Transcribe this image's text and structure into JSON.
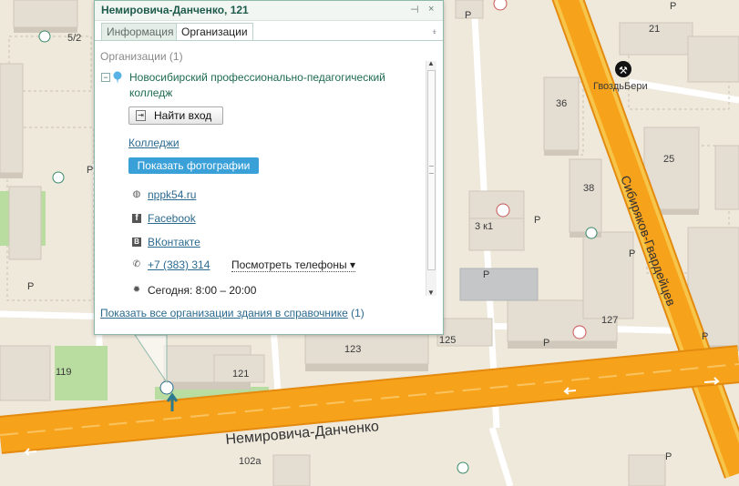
{
  "colors": {
    "road": "#f7a21b",
    "road_edge": "#e38a0f",
    "block": "#efe9dc",
    "green": "#b9dca0",
    "link": "#2b6a8f",
    "accent": "#3aa0d8",
    "popup_border": "#8fb9a9"
  },
  "map": {
    "streets": [
      "Немировича-Данченко",
      "Сибиряков-Гвардейцев"
    ],
    "building_numbers": [
      "121",
      "123",
      "125",
      "127",
      "119",
      "102а",
      "3 к1",
      "36",
      "38",
      "21",
      "25",
      "5/2"
    ],
    "poi": {
      "gvozd": "ГвоздьБери"
    },
    "parking": "P"
  },
  "popup": {
    "title": "Немировича-Данченко, 121",
    "pin_glyph": "⊣",
    "close_glyph": "×",
    "menu_glyph": "⍖",
    "tabs": [
      "Информация",
      "Организации"
    ],
    "org_header": "Организации (1)",
    "collapse_glyph": "−",
    "org_name_1": "Новосибирский профессионально-педагогический",
    "org_name_2": "колледж",
    "enter_button": "Найти вход",
    "category": "Колледжи",
    "photos_button": "Показать фотографии",
    "website": "nppk54.ru",
    "facebook": "Facebook",
    "vk": "ВКонтакте",
    "phone": "+7 (383) 314",
    "phone_more": "Посмотреть телефоны",
    "hours": "Сегодня: 8:00 – 20:00",
    "all_orgs_link": "Показать все организации здания в справочнике",
    "all_orgs_count": "(1)"
  }
}
